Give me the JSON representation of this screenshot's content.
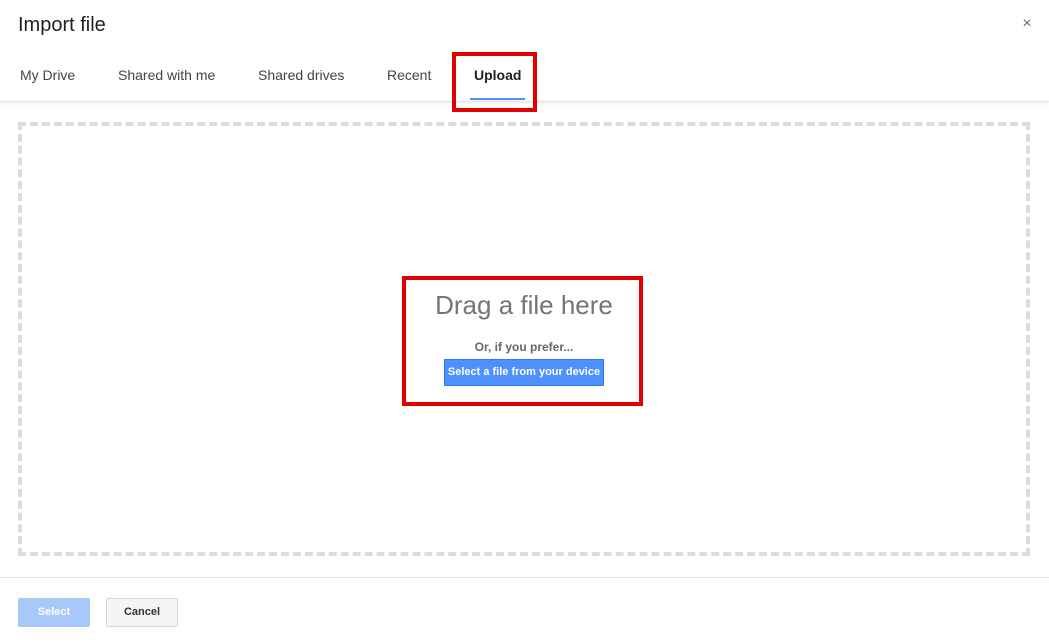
{
  "dialog": {
    "title": "Import file",
    "close_symbol": "×"
  },
  "tabs": [
    {
      "label": "My Drive",
      "active": false
    },
    {
      "label": "Shared with me",
      "active": false
    },
    {
      "label": "Shared drives",
      "active": false
    },
    {
      "label": "Recent",
      "active": false
    },
    {
      "label": "Upload",
      "active": true
    }
  ],
  "upload": {
    "drag_text": "Drag a file here",
    "prefer_text": "Or, if you prefer...",
    "select_device_label": "Select a file from your device"
  },
  "footer": {
    "select_label": "Select",
    "cancel_label": "Cancel"
  },
  "colors": {
    "accent": "#4d90fe",
    "highlight": "#e00000",
    "disabled_button": "#a7c8f8"
  },
  "icons": {
    "close": "close-icon"
  }
}
